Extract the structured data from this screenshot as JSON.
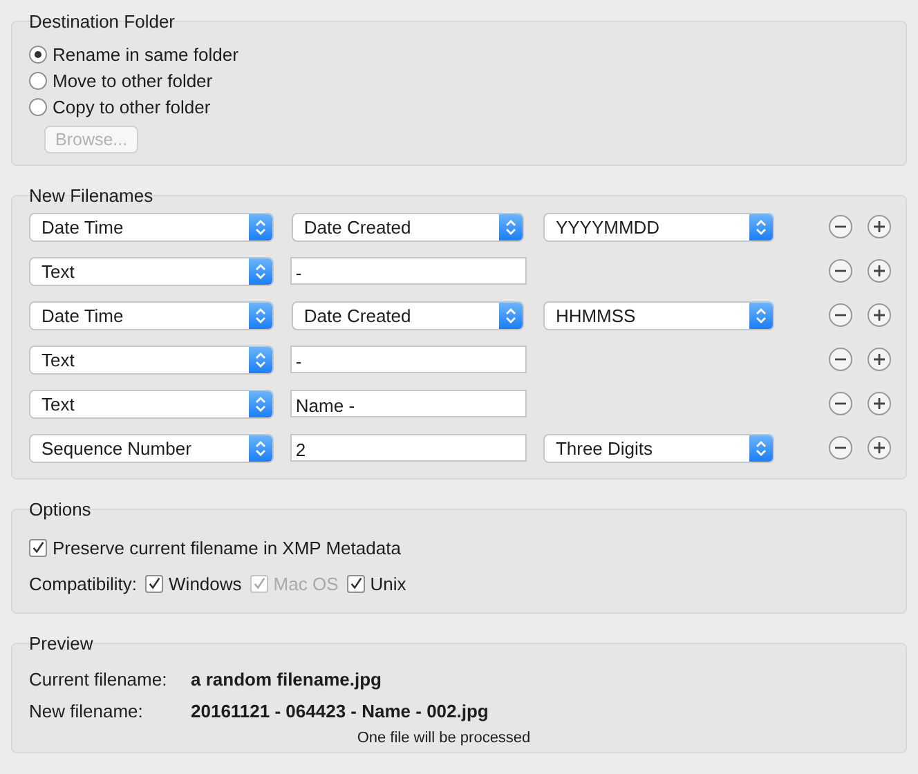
{
  "destination": {
    "title": "Destination Folder",
    "options": [
      {
        "label": "Rename in same folder",
        "selected": true
      },
      {
        "label": "Move to other folder",
        "selected": false
      },
      {
        "label": "Copy to other folder",
        "selected": false
      }
    ],
    "browse": {
      "label": "Browse...",
      "disabled": true
    }
  },
  "new_filenames": {
    "title": "New Filenames",
    "rows": [
      {
        "parts": [
          {
            "kind": "popup",
            "value": "Date Time"
          },
          {
            "kind": "popup",
            "value": "Date Created"
          },
          {
            "kind": "popup",
            "value": "YYYYMMDD"
          }
        ]
      },
      {
        "parts": [
          {
            "kind": "popup",
            "value": "Text"
          },
          {
            "kind": "field",
            "value": "-"
          }
        ]
      },
      {
        "parts": [
          {
            "kind": "popup",
            "value": "Date Time"
          },
          {
            "kind": "popup",
            "value": "Date Created"
          },
          {
            "kind": "popup",
            "value": "HHMMSS"
          }
        ]
      },
      {
        "parts": [
          {
            "kind": "popup",
            "value": "Text"
          },
          {
            "kind": "field",
            "value": "-"
          }
        ]
      },
      {
        "parts": [
          {
            "kind": "popup",
            "value": "Text"
          },
          {
            "kind": "field",
            "value": "Name -"
          }
        ]
      },
      {
        "parts": [
          {
            "kind": "popup",
            "value": "Sequence Number"
          },
          {
            "kind": "field",
            "value": "2"
          },
          {
            "kind": "popup",
            "value": "Three Digits"
          }
        ]
      }
    ]
  },
  "options": {
    "title": "Options",
    "preserve": {
      "label": "Preserve current filename in XMP Metadata",
      "checked": true
    },
    "compatibility_label": "Compatibility:",
    "compatibility": [
      {
        "label": "Windows",
        "checked": true,
        "disabled": false
      },
      {
        "label": "Mac OS",
        "checked": true,
        "disabled": true
      },
      {
        "label": "Unix",
        "checked": true,
        "disabled": false
      }
    ]
  },
  "preview": {
    "title": "Preview",
    "current_label": "Current filename:",
    "current_value": "a random filename.jpg",
    "new_label": "New filename:",
    "new_value": "20161121 - 064423 - Name - 002.jpg",
    "note": "One file will be processed"
  }
}
